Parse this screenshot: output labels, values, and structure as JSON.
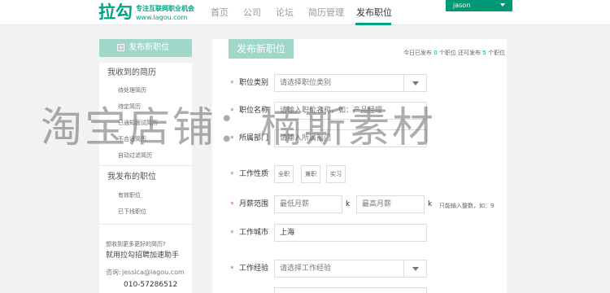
{
  "header": {
    "logo": {
      "main": "拉勾",
      "slogan": "专注互联网职业机会",
      "domain": "www.lagou.com"
    },
    "nav": [
      "首页",
      "公司",
      "论坛",
      "简历管理",
      "发布职位"
    ],
    "active_nav": "发布职位",
    "user": "jason"
  },
  "sidebar": {
    "post_button": "发布新职位",
    "received_title": "我收到的简历",
    "received_items": [
      "待处理简历",
      "待定简历",
      "已通知面试简历",
      "不合适简历",
      "自动过滤简历"
    ],
    "posted_title": "我发布的职位",
    "posted_items": [
      "有效职位",
      "已下线职位"
    ],
    "promo_question": "想收到更多更好的简历?",
    "promo_text": "就用拉勾招聘加速助手",
    "contact_label": "咨询:",
    "contact_email": "jessica@lagou.com",
    "contact_phone": "010-57286512"
  },
  "form": {
    "title": "发布新职位",
    "stats": {
      "prefix": "今日已发布",
      "posted": "0",
      "middle": "个职位 还可发布",
      "remaining": "5",
      "suffix": "个职位"
    },
    "required_mark": "*",
    "category": {
      "label": "职位类别",
      "placeholder": "请选择职位类别"
    },
    "name": {
      "label": "职位名称",
      "placeholder": "请输入职位名称，如：产品经理"
    },
    "department": {
      "label": "所属部门",
      "placeholder": "请输入所属部门"
    },
    "nature": {
      "label": "工作性质",
      "options": [
        "全职",
        "兼职",
        "实习"
      ]
    },
    "salary": {
      "label": "月薪范围",
      "min_placeholder": "最低月薪",
      "max_placeholder": "最高月薪",
      "unit": "k",
      "hint": "只能输入整数，如：9"
    },
    "city": {
      "label": "工作城市",
      "value": "上海"
    },
    "experience": {
      "label": "工作经验",
      "placeholder": "请选择工作经验"
    }
  },
  "watermark": "淘宝店铺：楠斯素材",
  "colors": {
    "brand": "#00a483",
    "button_light": "#9fd7c9",
    "user_bg": "#019875",
    "required": "#e45a5a"
  }
}
